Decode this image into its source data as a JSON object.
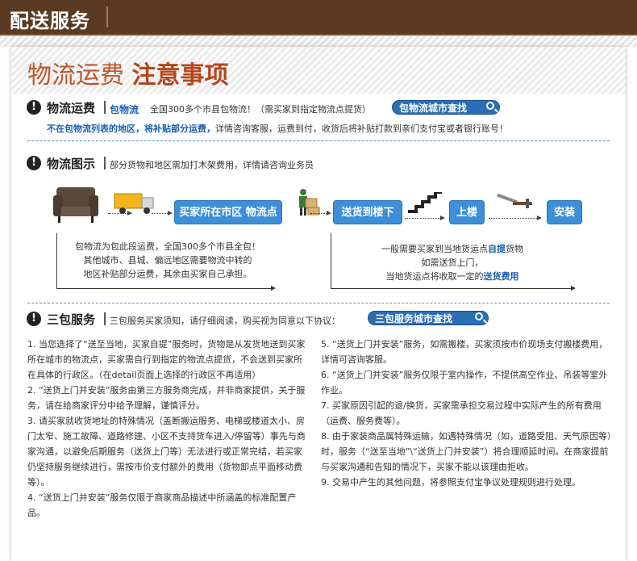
{
  "header": {
    "title": "配送服务"
  },
  "banner": {
    "title_part1": "物流运费",
    "title_part2": "注意事项"
  },
  "section1": {
    "title": "物流运费",
    "tag": "包物流",
    "desc": "全国300多个市县包物流！（需买家到指定物流点提货）",
    "button": "包物流城市查找",
    "note_highlight": "不在包物流列表的地区，将补贴部分运费，",
    "note_rest": "详情咨询客服，运费到付，收货后将补贴打款到亲们支付宝或者银行账号！"
  },
  "section2": {
    "title": "物流图示",
    "desc": "部分货物和地区需加打木架费用，详情请咨询业务员",
    "steps": [
      "买家所在市区 物流点",
      "送货到楼下",
      "上楼",
      "安装"
    ],
    "left_note": [
      "包物流为包此段运费，全国300多个市县全包！",
      "其他城市、县城、偏远地区需要物流中转的",
      "地区补贴部分运费，其余由买家自己承担。"
    ],
    "right_note_line1_a": "一般需要买家到当地货运点",
    "right_note_line1_b": "自提",
    "right_note_line1_c": "货物",
    "right_note_line2": "如需送货上门，",
    "right_note_line3_a": "当地货运点将收取一定的",
    "right_note_line3_b": "送货费用"
  },
  "section3": {
    "title": "三包服务",
    "desc": "三包服务买家须知，请仔细阅读，购买视为同意以下协议：",
    "button": "三包服务城市查找",
    "left_items": [
      "1. 当您选择了“送至当地，买家自提”服务时，货物是从发货地送到买家所在城市的物流点，买家需自行到指定的物流点提货，不会送到买家所在具体的行政区。（在detail页面上选择的行政区不再适用）",
      "2. “送货上门并安装”服务由第三方服务商完成，并非商家提供，关于服务，请在给商家评分中给予理解，谨慎评分。",
      "3. 请买家就收货地址的特殊情况（盖断搬运服务、电梯或楼道太小、房门太窄、施工故障、道路修建、小区不支持货车进入/停留等）事先与商家沟通，以避免后期服务（送货上门等）无法进行或正常完结，若买家仍坚持服务继续进行，需按市价支付额外的费用（货物卸点平面移动费等）。",
      "4. “送货上门并安装”服务仅限于商家商品描述中所涵盖的标准配置产品。"
    ],
    "right_items": [
      "5. “送货上门并安装”服务，如需搬楼，买家须按市价现场支付搬楼费用，详情可咨询客服。",
      "6. “送货上门并安装”服务仅限于室内操作，不提供高空作业、吊装等室外作业。",
      "7. 买家原因引起的退/换货，买家需承担交易过程中实际产生的所有费用（运费、服务费等）。",
      "8. 由于家装商品属特殊运输，如遇特殊情况（如，道路受阻、天气原因等）时，服务（“送至当地”\\“送货上门并安装”）将合理顺延时间。在商家提前与买家沟通和告知的情况下，买家不能以该理由拒收。",
      "9. 交易中产生的其他问题，将参照支付宝争议处理规则进行处理。"
    ]
  }
}
